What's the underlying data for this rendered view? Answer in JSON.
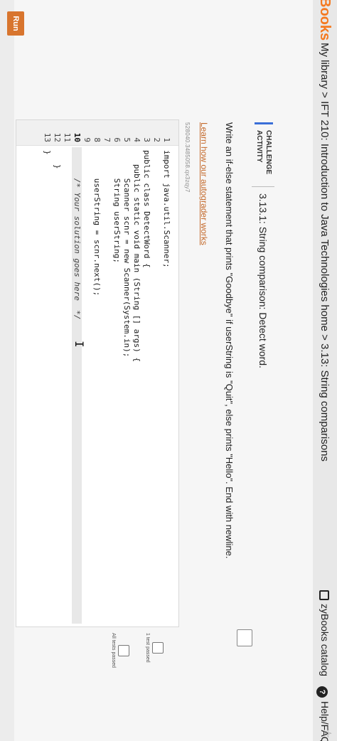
{
  "topbar": {
    "brand": "Books",
    "breadcrumb": "My library > IFT 210: Introduction to Java Technologies home > 3.13: String comparisons",
    "catalog_label": "zyBooks catalog",
    "help_label": "Help/FAQ",
    "icons": {
      "catalog": "book-icon",
      "help": "question-icon",
      "star": "star-icon"
    }
  },
  "challenge": {
    "label": "CHALLENGE ACTIVITY",
    "title": "3.13.1: String comparison: Detect word.",
    "instructions": "Write an if-else statement that prints \"Goodbye\" if userString is \"Quit\", else prints \"Hello\". End with newline.",
    "autograder_link": "Learn how our autograder works",
    "build_id": "528040.3485058.qx3zqy7"
  },
  "editor": {
    "line_numbers": [
      "1",
      "2",
      "3",
      "4",
      "5",
      "6",
      "7",
      "8",
      "9",
      "10",
      "11",
      "12",
      "13"
    ],
    "lines": [
      "import java.util.Scanner;",
      "",
      "public class DetectWord {",
      "   public static void main (String [] args) {",
      "      Scanner scnr = new Scanner(System.in);",
      "      String userString;",
      "",
      "      userString = scnr.next();",
      "",
      "      /* Your solution goes here  */",
      "",
      "   }",
      "}"
    ],
    "highlight_line": 10
  },
  "tests": [
    {
      "label": "1 test passed"
    },
    {
      "label": "All tests passed"
    }
  ],
  "run_label": "Run",
  "colors": {
    "brand": "#f5791f",
    "accent": "#3a6fd8",
    "link": "#c46a2c",
    "run": "#d8752e"
  }
}
